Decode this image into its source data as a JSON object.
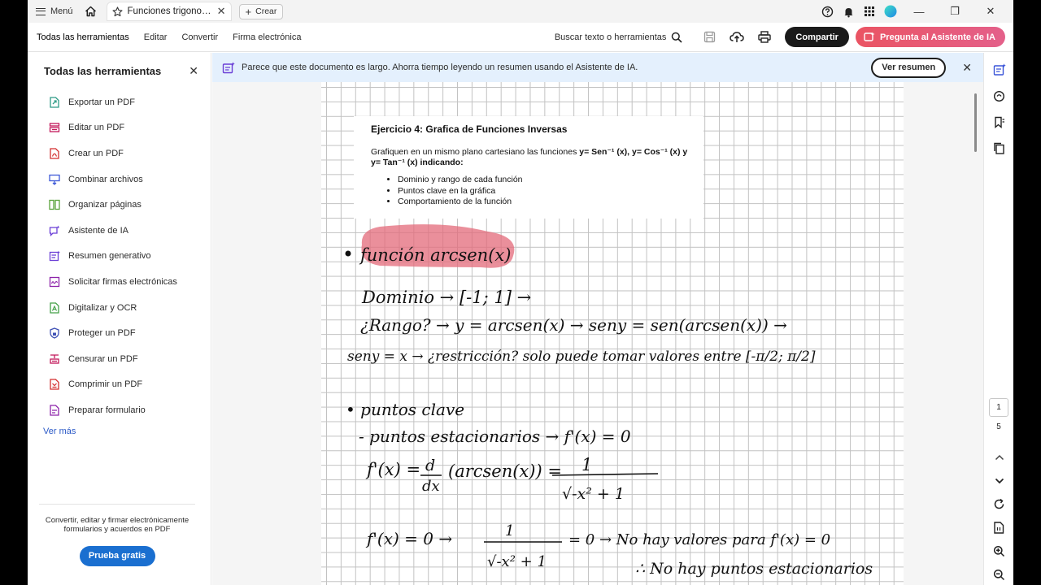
{
  "titlebar": {
    "menu_label": "Menú",
    "tab_title": "Funciones trigonomet...",
    "new_tab_label": "Crear"
  },
  "toolbar": {
    "tabs": [
      "Todas las herramientas",
      "Editar",
      "Convertir",
      "Firma electrónica"
    ],
    "search_label": "Buscar texto o herramientas",
    "share_label": "Compartir",
    "ai_label": "Pregunta al Asistente de IA"
  },
  "left_panel": {
    "title": "Todas las herramientas",
    "tools": [
      {
        "label": "Exportar un PDF",
        "icon": "export-pdf-icon",
        "color": "#2e9b86"
      },
      {
        "label": "Editar un PDF",
        "icon": "edit-pdf-icon",
        "color": "#c2185b"
      },
      {
        "label": "Crear un PDF",
        "icon": "create-pdf-icon",
        "color": "#d32f2f"
      },
      {
        "label": "Combinar archivos",
        "icon": "combine-files-icon",
        "color": "#3f5bd8"
      },
      {
        "label": "Organizar páginas",
        "icon": "organize-pages-icon",
        "color": "#5aa33b"
      },
      {
        "label": "Asistente de IA",
        "icon": "ai-assistant-icon",
        "color": "#6b3fd6"
      },
      {
        "label": "Resumen generativo",
        "icon": "generative-summary-icon",
        "color": "#6b3fd6"
      },
      {
        "label": "Solicitar firmas electrónicas",
        "icon": "request-signatures-icon",
        "color": "#8e24aa"
      },
      {
        "label": "Digitalizar y OCR",
        "icon": "scan-ocr-icon",
        "color": "#43a047"
      },
      {
        "label": "Proteger un PDF",
        "icon": "protect-pdf-icon",
        "color": "#3f51b5"
      },
      {
        "label": "Censurar un PDF",
        "icon": "redact-pdf-icon",
        "color": "#c2185b"
      },
      {
        "label": "Comprimir un PDF",
        "icon": "compress-pdf-icon",
        "color": "#d32f2f"
      },
      {
        "label": "Preparar formulario",
        "icon": "prepare-form-icon",
        "color": "#8e24aa"
      }
    ],
    "see_more": "Ver más",
    "footer_text": "Convertir, editar y firmar electrónicamente formularios y acuerdos en PDF",
    "trial_button": "Prueba gratis"
  },
  "banner": {
    "text": "Parece que este documento es largo. Ahorra tiempo leyendo un resumen usando el Asistente de IA.",
    "button": "Ver resumen"
  },
  "document": {
    "exercise_title": "Ejercicio 4: Grafica de Funciones Inversas",
    "exercise_text_plain": "Grafiquen en un mismo plano cartesiano las funciones ",
    "exercise_text_bold": "y= Sen⁻¹ (x), y= Cos⁻¹ (x) y y= Tan⁻¹ (x) indicando:",
    "bullets": [
      "Dominio y rango de cada función",
      "Puntos clave en la gráfica",
      "Comportamiento de la función"
    ],
    "handwritten": {
      "heading": "función arcsen(x)",
      "line1": "Dominio → [-1; 1] →",
      "line2": "¿Rango? → y = arcsen(x) → seny = sen(arcsen(x)) →",
      "line3": "seny = x → ¿restricción? solo puede tomar valores entre [-π/2; π/2]",
      "line4": "• puntos clave",
      "line5": "- puntos estacionarios → f'(x) = 0",
      "line6a": "f'(x) =",
      "line6d": "d",
      "line6dx": "dx",
      "line6b": "(arcsen(x)) =",
      "line6num": "1",
      "line6den": "√-x² + 1",
      "line7a": "f'(x) = 0 →",
      "line7num": "1",
      "line7den": "√-x² + 1",
      "line7b": "= 0 → No hay valores para f'(x) = 0",
      "line8": "∴ No hay puntos estacionarios"
    }
  },
  "right_rail": {
    "page_current": "1",
    "page_total": "5"
  }
}
